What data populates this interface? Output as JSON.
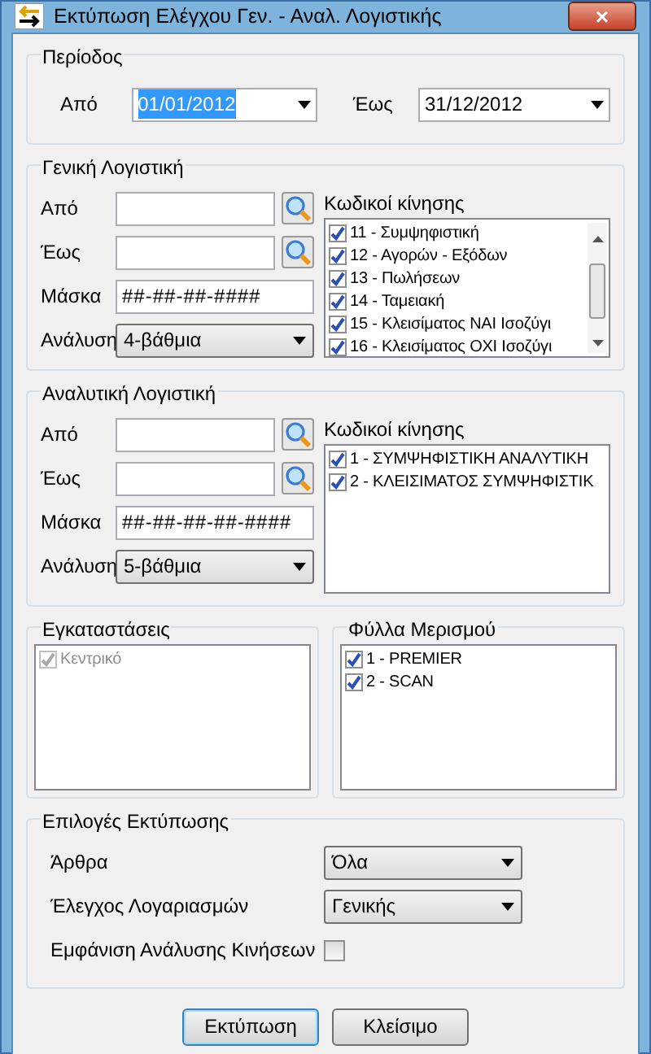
{
  "window": {
    "title": "Εκτύπωση Ελέγχου Γεν. - Αναλ. Λογιστικής",
    "close": "×"
  },
  "period": {
    "title": "Περίοδος",
    "fields": [
      {
        "label": "Από",
        "value": "01/01/2012",
        "highlighted": true
      },
      {
        "label": "Έως",
        "value": "31/12/2012",
        "highlighted": false
      }
    ]
  },
  "sections": [
    {
      "title": "Γενική Λογιστική",
      "from_label": "Από",
      "to_label": "Έως",
      "mask_label": "Μάσκα",
      "mask": "##-##-##-####",
      "analysis_label": "Ανάλυση",
      "analysis": "4-βάθμια",
      "codes_label": "Κωδικοί κίνησης",
      "scrollable": true,
      "codes": [
        {
          "label": "11 - Συμψηφιστική",
          "checked": true
        },
        {
          "label": "12 - Αγορών - Εξόδων",
          "checked": true
        },
        {
          "label": "13 - Πωλήσεων",
          "checked": true
        },
        {
          "label": "14 - Ταμειακή",
          "checked": true
        },
        {
          "label": "15 - Κλεισίματος ΝΑΙ Ισοζύγι",
          "checked": true
        },
        {
          "label": "16 - Κλεισίματος ΟΧΙ Ισοζύγι",
          "checked": true
        }
      ]
    },
    {
      "title": "Αναλυτική Λογιστική",
      "from_label": "Από",
      "to_label": "Έως",
      "mask_label": "Μάσκα",
      "mask": "##-##-##-##-####",
      "analysis_label": "Ανάλυση",
      "analysis": "5-βάθμια",
      "codes_label": "Κωδικοί κίνησης",
      "scrollable": false,
      "codes": [
        {
          "label": "1 - ΣΥΜΨΗΦΙΣΤΙΚΗ ΑΝΑΛΥΤΙΚΗ",
          "checked": true
        },
        {
          "label": "2 - ΚΛΕΙΣΙΜΑΤΟΣ ΣΥΜΨΗΦΙΣΤΙΚ",
          "checked": true
        }
      ]
    }
  ],
  "lists": [
    {
      "title": "Εγκαταστάσεις",
      "items": [
        {
          "label": "Κεντρικό",
          "checked": true,
          "disabled": true
        }
      ]
    },
    {
      "title": "Φύλλα Μερισμού",
      "items": [
        {
          "label": "1 - PREMIER",
          "checked": true,
          "disabled": false
        },
        {
          "label": "2 - SCAN",
          "checked": true,
          "disabled": false
        }
      ]
    }
  ],
  "options": {
    "title": "Επιλογές Εκτύπωσης",
    "rows": [
      {
        "kind": "select",
        "label": "Άρθρα",
        "value": "Όλα"
      },
      {
        "kind": "select",
        "label": "Έλεγχος Λογαριασμών",
        "value": "Γενικής"
      },
      {
        "kind": "checkbox",
        "label": "Εμφάνιση Ανάλυσης Κινήσεων",
        "checked": false
      }
    ]
  },
  "buttons": [
    {
      "label": "Εκτύπωση",
      "default": true
    },
    {
      "label": "Κλείσιμο",
      "default": false
    }
  ]
}
